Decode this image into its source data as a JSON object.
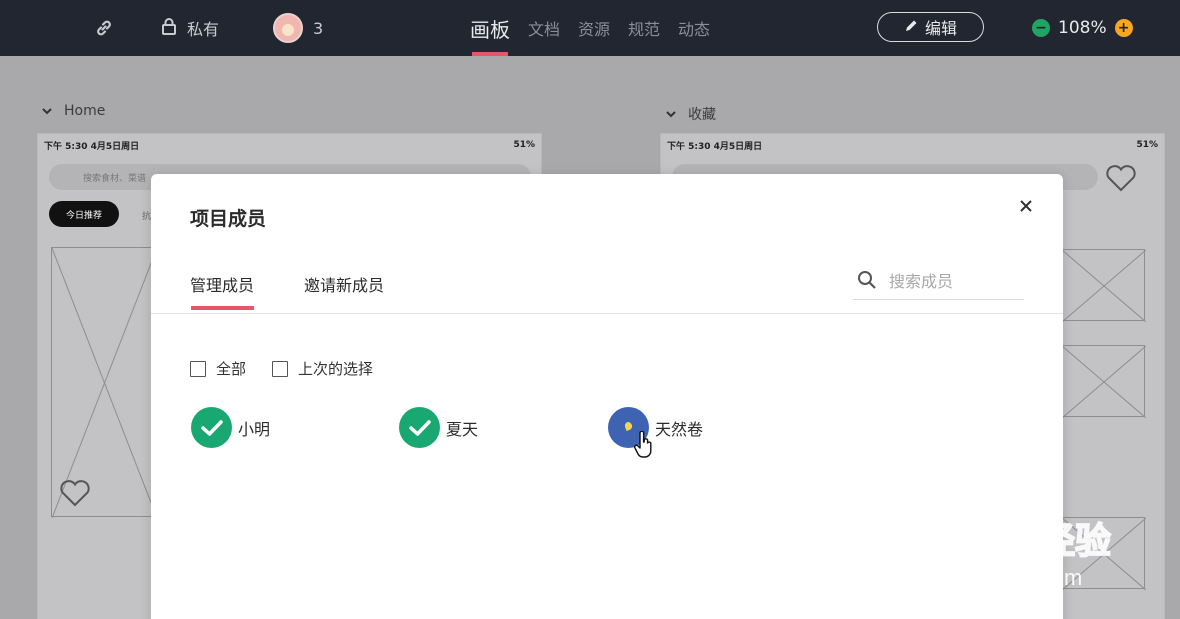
{
  "topbar": {
    "private_label": "私有",
    "member_count": "3",
    "tabs": [
      {
        "label": "画板",
        "active": true
      },
      {
        "label": "文档",
        "active": false
      },
      {
        "label": "资源",
        "active": false
      },
      {
        "label": "规范",
        "active": false
      },
      {
        "label": "动态",
        "active": false
      }
    ],
    "edit_label": "编辑",
    "zoom": "108%"
  },
  "canvas": {
    "left_section": "Home",
    "right_section": "收藏",
    "status_time": "下午 5:30  4月5日周日",
    "status_battery": "51%",
    "search_placeholder": "搜索食材、菜谱",
    "pill_label": "今日推荐",
    "pill_next": "抗"
  },
  "modal": {
    "title": "项目成员",
    "tabs": [
      {
        "label": "管理成员",
        "active": true
      },
      {
        "label": "邀请新成员",
        "active": false
      }
    ],
    "search_placeholder": "搜索成员",
    "filters": [
      {
        "label": "全部",
        "checked": false
      },
      {
        "label": "上次的选择",
        "checked": false
      }
    ],
    "members": [
      {
        "name": "小明",
        "selected": true
      },
      {
        "name": "夏天",
        "selected": true
      },
      {
        "name": "天然卷",
        "selected": false
      }
    ]
  },
  "watermark": {
    "line1": "Bai du 经验",
    "line2": "jingyan.baidu.com"
  },
  "colors": {
    "topbar_bg": "#222630",
    "accent": "#e5566b",
    "selected_green": "#1aa872",
    "zoom_minus": "#1fa463",
    "zoom_plus": "#f5a623",
    "avatar_blue": "#3e63b3"
  }
}
